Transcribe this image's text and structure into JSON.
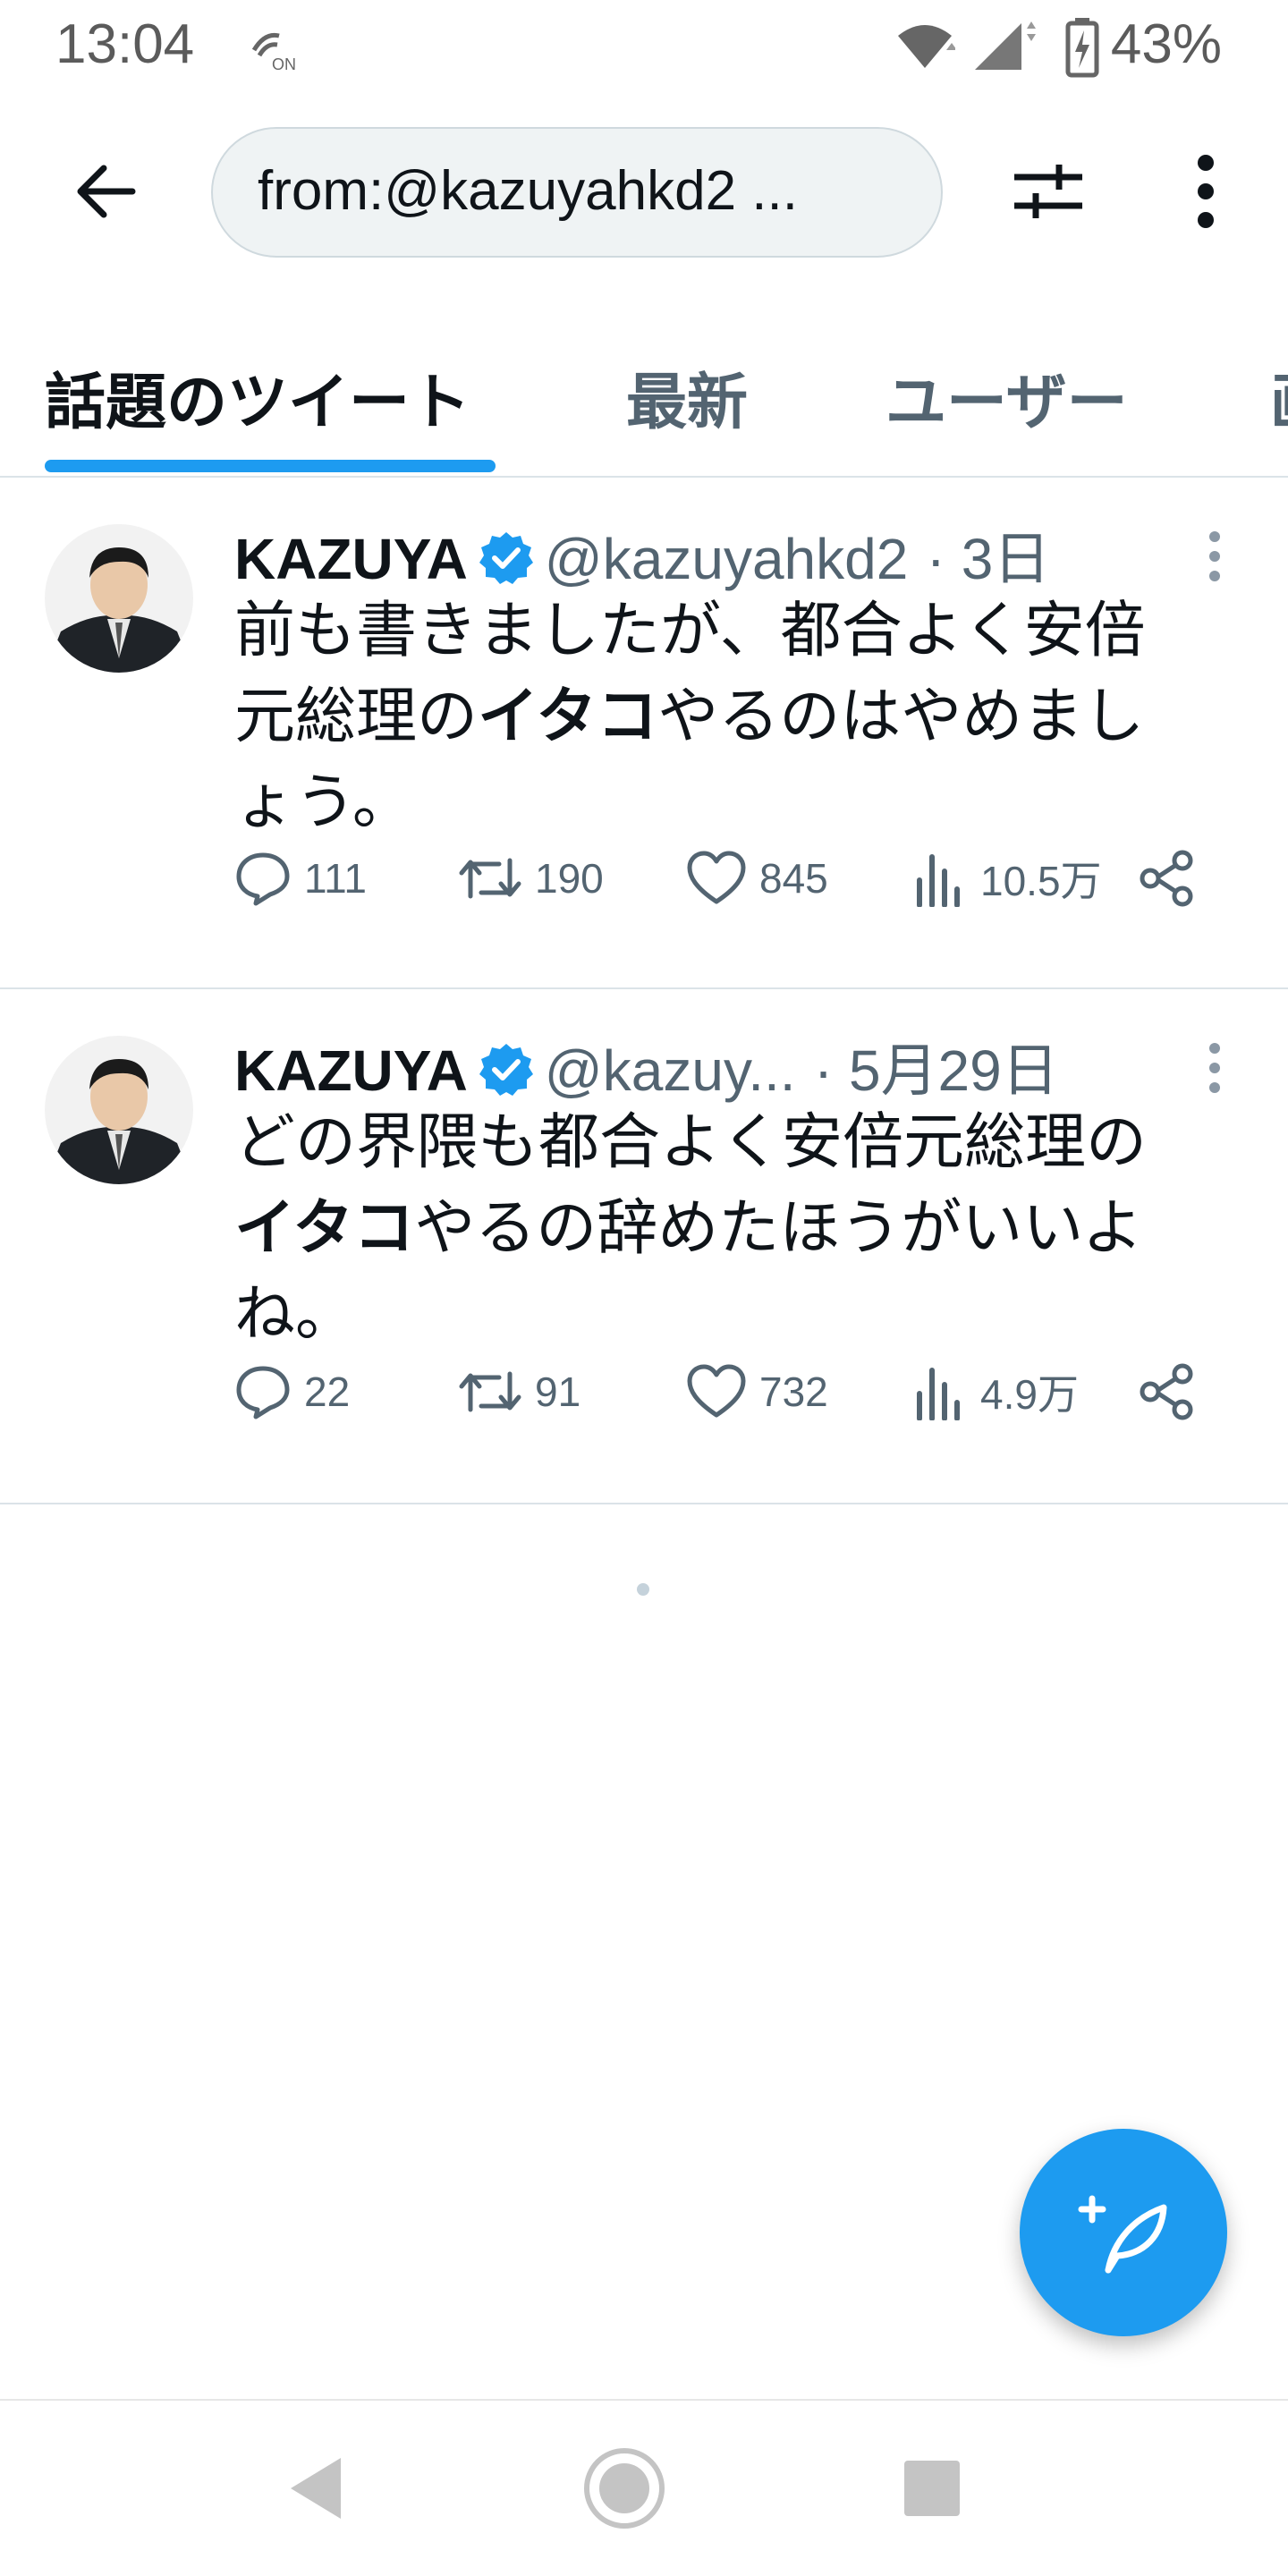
{
  "status_bar": {
    "time": "13:04",
    "battery": "43%",
    "icons": [
      "nfc-on-icon",
      "wifi-icon",
      "signal-icon",
      "battery-charging-icon"
    ]
  },
  "search": {
    "query": "from:@kazuyahkd2 ..."
  },
  "tabs": [
    {
      "label": "話題のツイート",
      "active": true
    },
    {
      "label": "最新",
      "active": false
    },
    {
      "label": "ユーザー",
      "active": false
    },
    {
      "label": "画",
      "active": false
    }
  ],
  "tweets": [
    {
      "author": "KAZUYA",
      "handle": "@kazuyahkd2",
      "time": "· 3日",
      "text_before": "前も書きましたが、都合よく安倍元総理の",
      "text_bold": "イタコ",
      "text_after": "やるのはやめましょう。",
      "replies": "111",
      "retweets": "190",
      "likes": "845",
      "views": "10.5万"
    },
    {
      "author": "KAZUYA",
      "handle": "@kazuy...",
      "time": "· 5月29日",
      "text_before": "どの界隈も都合よく安倍元総理の",
      "text_bold": "イタコ",
      "text_after": "やるの辞めたほうがいいよね。",
      "replies": "22",
      "retweets": "91",
      "likes": "732",
      "views": "4.9万"
    }
  ],
  "colors": {
    "accent": "#1d9bf0",
    "text_primary": "#0f1419",
    "text_secondary": "#536471"
  }
}
